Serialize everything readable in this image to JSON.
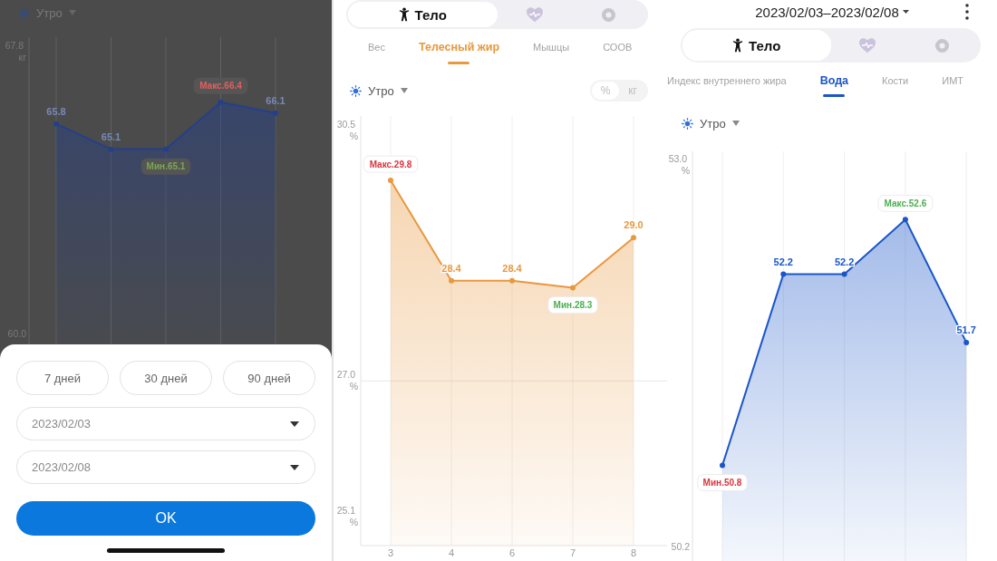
{
  "screens": [
    {
      "dimmed": true,
      "period": "Утро",
      "extreme_badges": [
        {
          "kind": "max",
          "color": "#e06060"
        },
        {
          "kind": "min",
          "color": "#7aa850"
        }
      ],
      "chart_data": {
        "type": "area",
        "grid": true,
        "series": [
          {
            "color": "#24408a",
            "values": [
              65.8,
              65.1,
              65.1,
              66.4,
              66.1
            ]
          }
        ],
        "ylim": [
          59.7,
          68.2
        ],
        "yticks": [
          {
            "value": 67.8,
            "label": "67.8 кг"
          },
          {
            "value": 60.0,
            "label": "60.0"
          }
        ],
        "value_labels": [
          "65.8",
          "65.1",
          "Мин.65.1",
          "Макс.66.4",
          "66.1"
        ]
      },
      "date_sheet": {
        "presets": [
          {
            "label": "7 дней",
            "selected": false
          },
          {
            "label": "30 дней",
            "selected": false
          },
          {
            "label": "90 дней",
            "selected": false
          }
        ],
        "start_date": "2023/02/03",
        "end_date": "2023/02/08",
        "confirm": "OK"
      }
    },
    {
      "dimmed": false,
      "main_tabs": [
        {
          "label": "Тело",
          "selected": true
        },
        {
          "selected": false
        },
        {
          "selected": false
        }
      ],
      "metric_tabs": [
        {
          "label": "Вес",
          "selected": false
        },
        {
          "label": "Телесный жир",
          "selected": true
        },
        {
          "label": "Мышцы",
          "selected": false
        },
        {
          "label": "СООВ",
          "selected": false
        }
      ],
      "period": "Утро",
      "unit_toggle": [
        {
          "label": "%",
          "selected": true
        },
        {
          "label": "кг",
          "selected": false
        }
      ],
      "extreme_badges": [
        {
          "kind": "max",
          "color": "#d9363e"
        },
        {
          "kind": "min",
          "color": "#4caf50"
        }
      ],
      "chart_data": {
        "type": "area",
        "grid": true,
        "categories": [
          "3",
          "4",
          "6",
          "7",
          "8"
        ],
        "series": [
          {
            "color": "#e8983f",
            "values": [
              29.8,
              28.4,
              28.4,
              28.3,
              29.0
            ]
          }
        ],
        "ylim": [
          24.7,
          30.7
        ],
        "yticks": [
          {
            "value": 30.5,
            "label": "30.5 %"
          },
          {
            "value": 27.0,
            "label": "27.0 %"
          },
          {
            "value": 25.1,
            "label": "25.1 %"
          }
        ],
        "ref_lines": [
          {
            "axis": "y",
            "value": 27.0
          }
        ],
        "value_labels": [
          "Макс.29.8",
          "28.4",
          "28.4",
          "Мин.28.3",
          "29.0"
        ]
      }
    },
    {
      "dimmed": false,
      "date_range": "2023/02/03–2023/02/08",
      "main_tabs": [
        {
          "label": "Тело",
          "selected": true
        },
        {
          "selected": false
        },
        {
          "selected": false
        }
      ],
      "metric_tabs": [
        {
          "label": "Индекс внутреннего жира",
          "selected": false
        },
        {
          "label": "Вода",
          "selected": true
        },
        {
          "label": "Кости",
          "selected": false
        },
        {
          "label": "ИМТ",
          "selected": false
        }
      ],
      "period": "Утро",
      "extreme_badges": [
        {
          "kind": "max",
          "color": "#4caf50"
        },
        {
          "kind": "min",
          "color": "#d9363e"
        }
      ],
      "chart_data": {
        "type": "area",
        "grid": true,
        "series": [
          {
            "color": "#1a56c8",
            "values": [
              50.8,
              52.2,
              52.2,
              52.6,
              51.7
            ]
          }
        ],
        "ylim": [
          50.1,
          53.1
        ],
        "yticks": [
          {
            "value": 53.0,
            "label": "53.0 %"
          },
          {
            "value": 50.2,
            "label": "50.2"
          }
        ],
        "value_labels": [
          "Мин.50.8",
          "52.2",
          "52.2",
          "Макс.52.6",
          "51.7"
        ]
      }
    }
  ]
}
